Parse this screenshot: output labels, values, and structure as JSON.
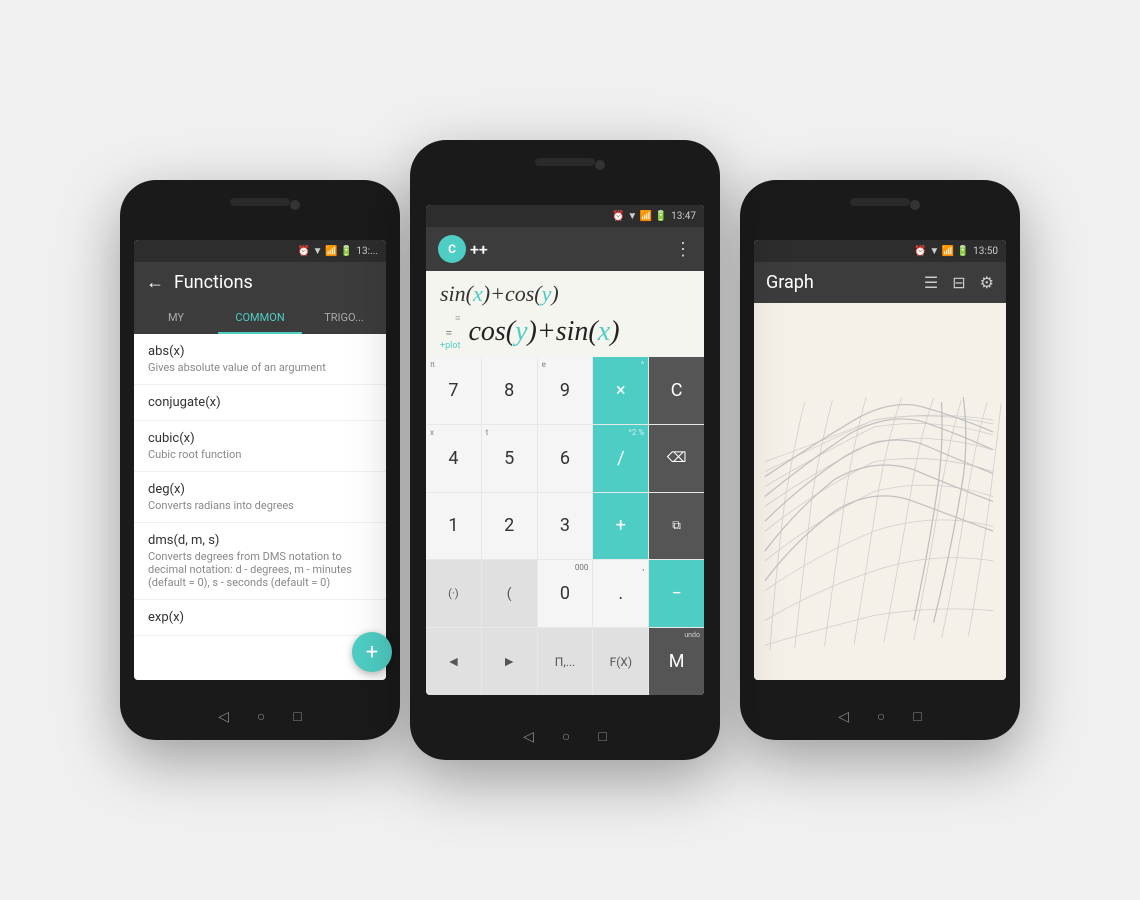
{
  "left_phone": {
    "status": "13:...",
    "title": "Functions",
    "tabs": [
      "MY",
      "COMMON",
      "TRIGONO..."
    ],
    "functions": [
      {
        "name": "abs(x)",
        "desc": "Gives absolute value of an argument"
      },
      {
        "name": "conjugate(x)",
        "desc": ""
      },
      {
        "name": "cubic(x)",
        "desc": "Cubic root function"
      },
      {
        "name": "deg(x)",
        "desc": "Converts radians into degrees"
      },
      {
        "name": "dms(d, m, s)",
        "desc": "Converts degrees from DMS notation to decimal notation: d - degrees, m - minutes (default = 0), s - seconds (default = 0)"
      },
      {
        "name": "exp(x)",
        "desc": ""
      }
    ],
    "fab_label": "+"
  },
  "center_phone": {
    "status": "13:47",
    "logo_text": "++",
    "expression": "sin(x)+cos(y)",
    "result": "cos(y)+sin(x)",
    "keys": [
      {
        "label": "7",
        "type": "normal",
        "sub": "π"
      },
      {
        "label": "8",
        "type": "normal",
        "sub": ""
      },
      {
        "label": "9",
        "type": "normal",
        "sub": "e"
      },
      {
        "label": "×",
        "type": "teal",
        "sub": "^"
      },
      {
        "label": "C",
        "type": "dark"
      },
      {
        "label": "4",
        "type": "normal",
        "sub": "x"
      },
      {
        "label": "5",
        "type": "normal",
        "sub": "t"
      },
      {
        "label": "6",
        "type": "normal",
        "sub": ""
      },
      {
        "label": "/",
        "type": "teal",
        "sub": "^2 %"
      },
      {
        "label": "⌫",
        "type": "dark"
      },
      {
        "label": "1",
        "type": "normal"
      },
      {
        "label": "2",
        "type": "normal"
      },
      {
        "label": "3",
        "type": "normal"
      },
      {
        "label": "+",
        "type": "teal"
      },
      {
        "label": "📋",
        "type": "dark"
      },
      {
        "label": "(.)",
        "type": "special"
      },
      {
        "label": "(",
        "type": "special"
      },
      {
        "label": "0",
        "type": "normal",
        "sub": "000"
      },
      {
        "label": ".",
        "type": "normal",
        "sub": ","
      },
      {
        "label": "−",
        "type": "teal"
      },
      {
        "label": "◄",
        "type": "special"
      },
      {
        "label": "►",
        "type": "special"
      },
      {
        "label": "Π,...",
        "type": "special"
      },
      {
        "label": "F(X)",
        "type": "special"
      },
      {
        "label": "M",
        "type": "dark",
        "sub": "undo/redo"
      }
    ]
  },
  "right_phone": {
    "status": "13:50",
    "title": "Graph",
    "icons": [
      "☰",
      "💾",
      "⚙"
    ]
  }
}
